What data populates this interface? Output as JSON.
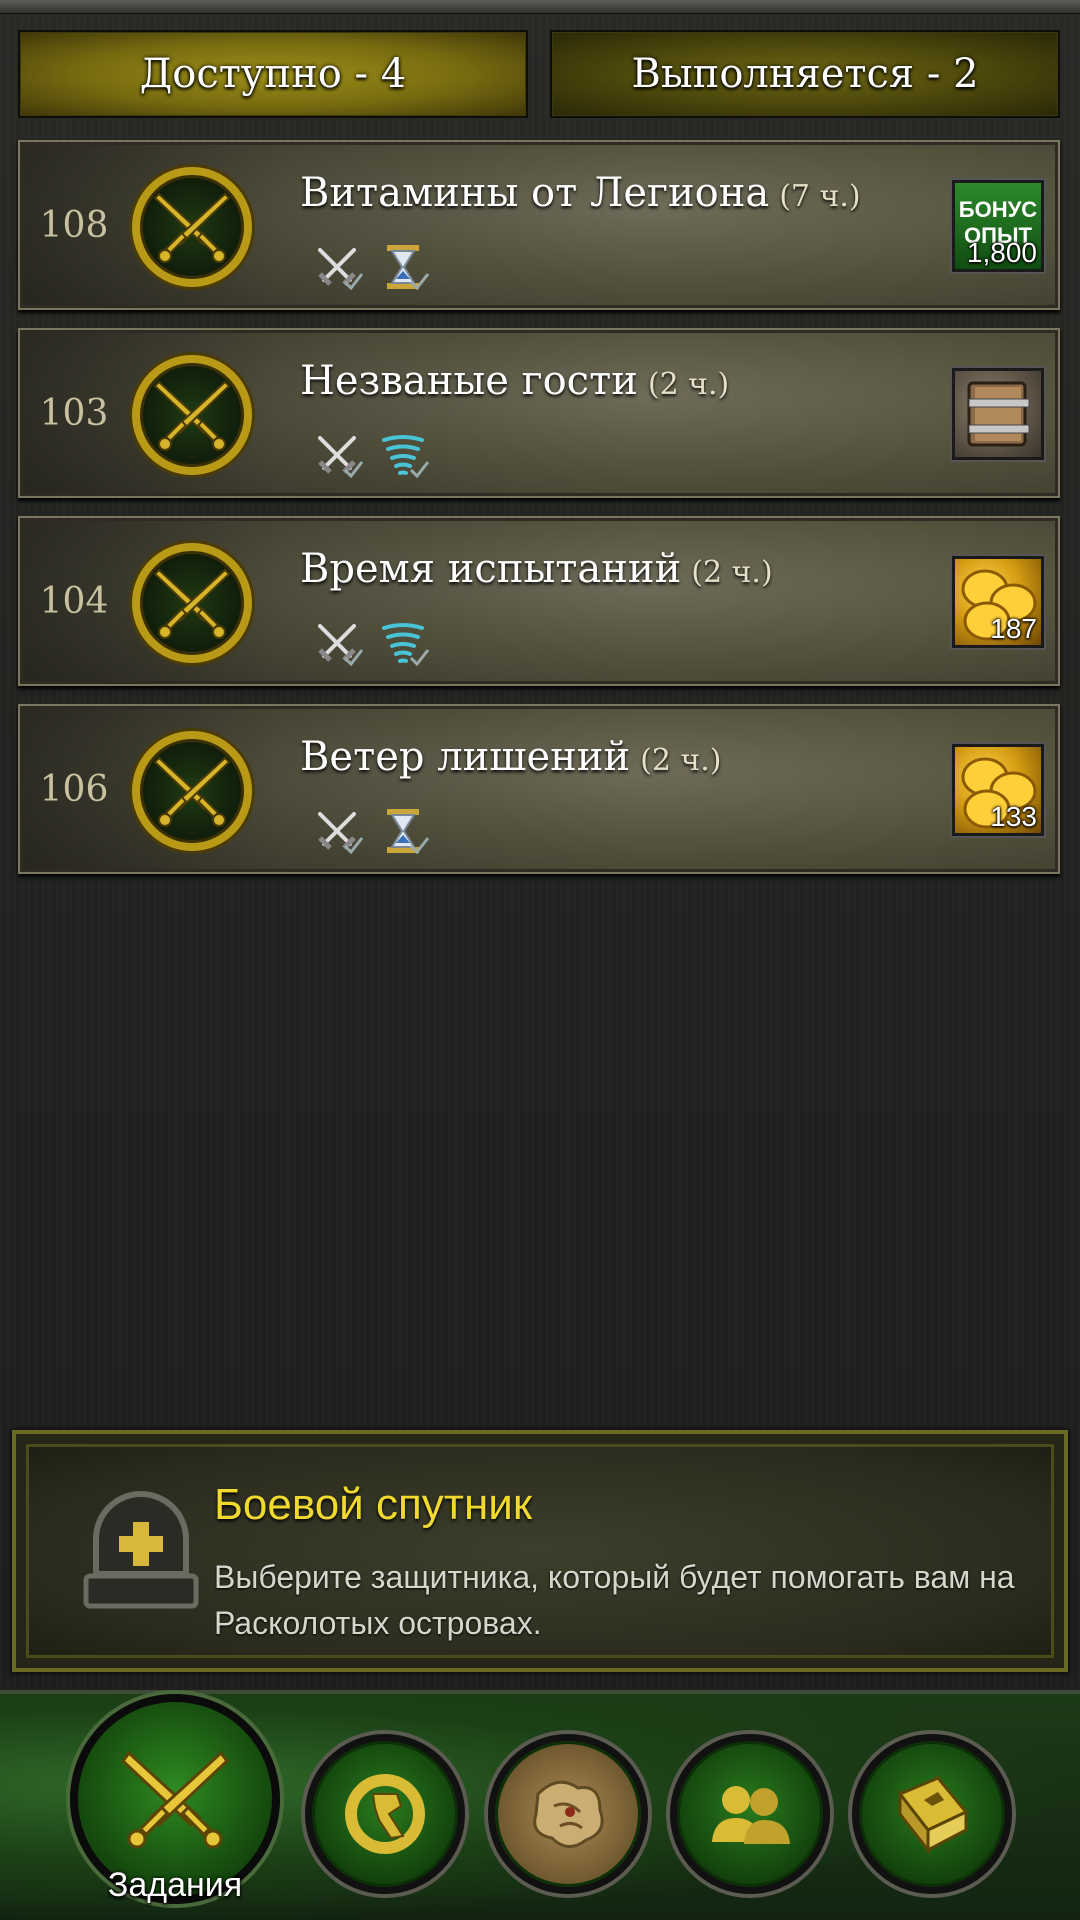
{
  "tabs": [
    {
      "label": "Доступно - 4",
      "state": "active"
    },
    {
      "label": "Выполняется - 2",
      "state": "inactive"
    }
  ],
  "missions": [
    {
      "level": "108",
      "title": "Витамины от Легиона",
      "duration": "(7 ч.)",
      "mechanics": [
        "crossed-swords-icon",
        "hourglass-icon"
      ],
      "reward": {
        "type": "bonus-xp",
        "label_line1": "БОНУС",
        "label_line2": "ОПЫТ",
        "amount": "1,800"
      }
    },
    {
      "level": "103",
      "title": "Незваные гости",
      "duration": "(2 ч.)",
      "mechanics": [
        "crossed-swords-icon",
        "whirlwind-icon"
      ],
      "reward": {
        "type": "book",
        "amount": ""
      }
    },
    {
      "level": "104",
      "title": "Время испытаний",
      "duration": "(2 ч.)",
      "mechanics": [
        "crossed-swords-icon",
        "whirlwind-icon"
      ],
      "reward": {
        "type": "gold",
        "amount": "187"
      }
    },
    {
      "level": "106",
      "title": "Ветер лишений",
      "duration": "(2 ч.)",
      "mechanics": [
        "crossed-swords-icon",
        "hourglass-icon"
      ],
      "reward": {
        "type": "gold",
        "amount": "133"
      }
    }
  ],
  "companion": {
    "title": "Боевой спутник",
    "description": "Выберите защитника, который будет помогать вам на Расколотых островах."
  },
  "nav": {
    "active_label": "Задания",
    "items": [
      "missions-icon",
      "class-hall-icon",
      "map-icon",
      "followers-icon",
      "troops-book-icon"
    ]
  },
  "colors": {
    "accent_gold": "#b89a17",
    "title_yellow": "#f2d930",
    "tab_active": "#9c8f18"
  }
}
